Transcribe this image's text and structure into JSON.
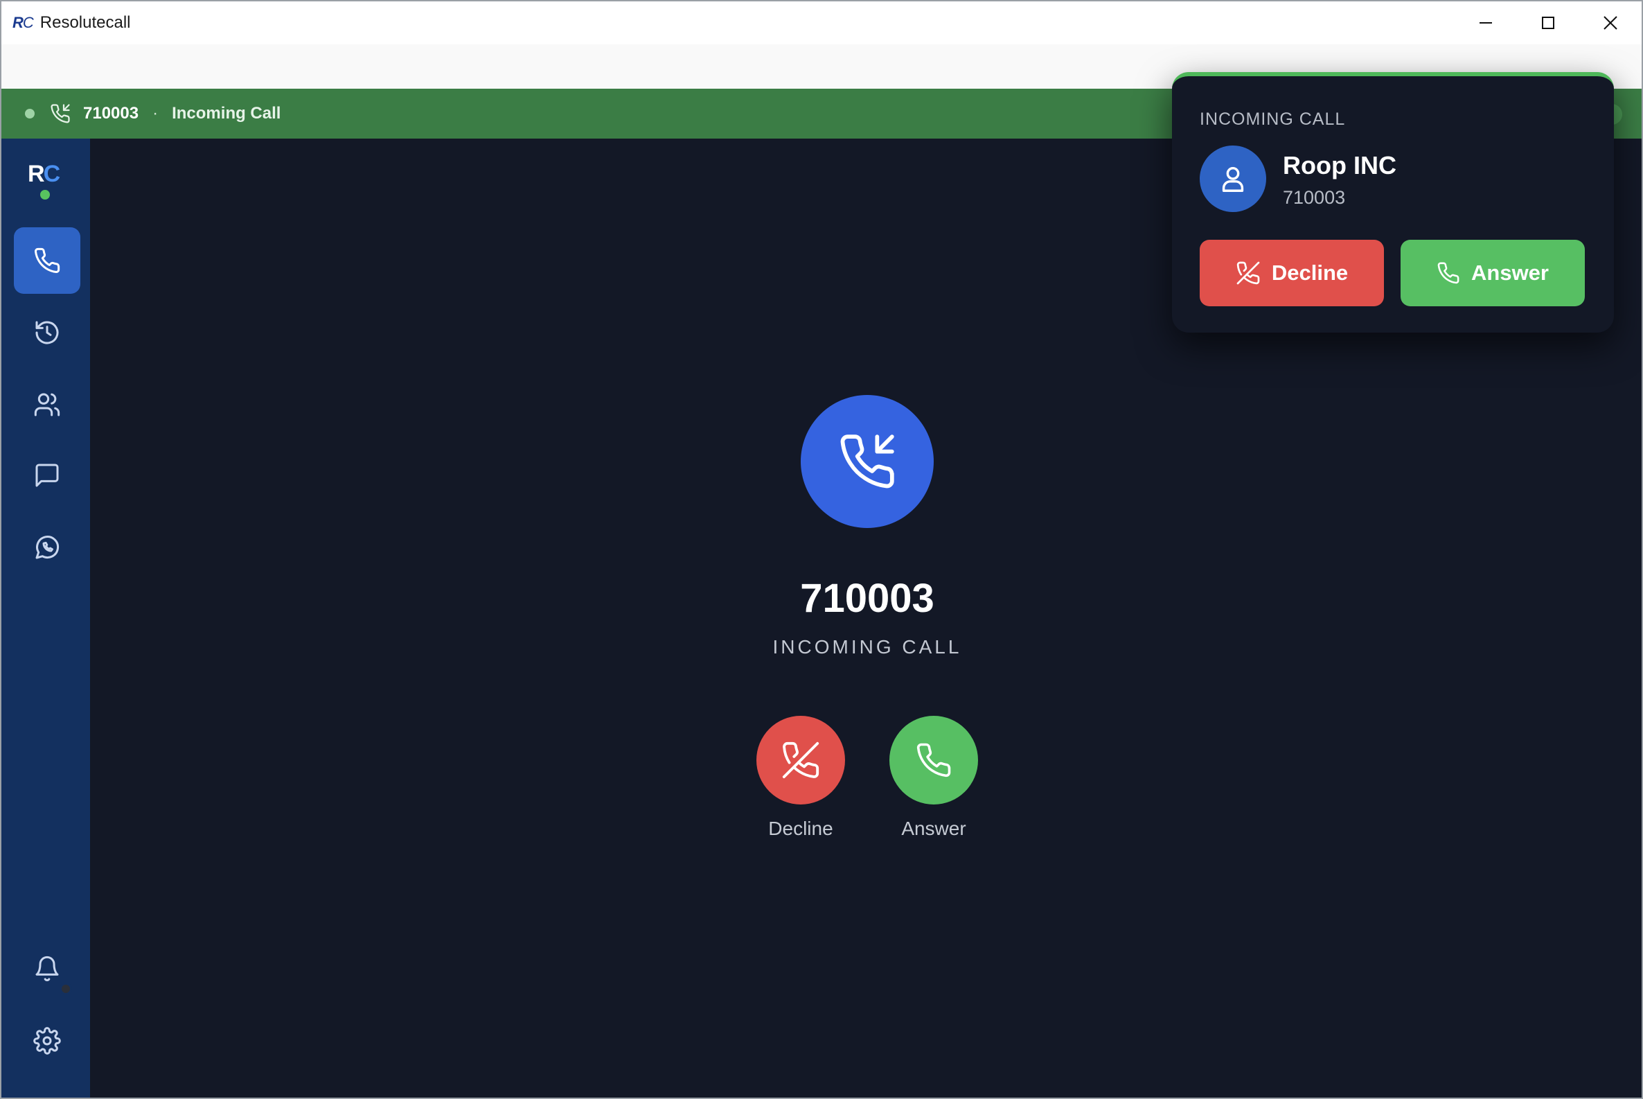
{
  "window": {
    "logo_text_r": "R",
    "logo_text_c": "C",
    "title": "Resolutecall",
    "controls": [
      "minimize-icon",
      "maximize-icon",
      "close-icon"
    ]
  },
  "status_bar": {
    "number": "710003",
    "separator": "·",
    "status": "Incoming Call",
    "color": "#3b7d45"
  },
  "sidebar": {
    "logo_r": "R",
    "logo_c": "C",
    "items": [
      {
        "icon": "phone-icon",
        "active": true
      },
      {
        "icon": "history-icon",
        "active": false
      },
      {
        "icon": "contacts-icon",
        "active": false
      },
      {
        "icon": "chat-icon",
        "active": false
      },
      {
        "icon": "whatsapp-icon",
        "active": false
      }
    ],
    "bottom_items": [
      {
        "icon": "bell-icon"
      },
      {
        "icon": "gear-icon"
      }
    ]
  },
  "main": {
    "number": "710003",
    "status": "INCOMING CALL",
    "decline_label": "Decline",
    "answer_label": "Answer"
  },
  "popup": {
    "heading": "INCOMING CALL",
    "name": "Roop INC",
    "number": "710003",
    "decline_label": "Decline",
    "answer_label": "Answer"
  },
  "colors": {
    "decline": "#e0504b",
    "answer": "#57bf63",
    "accent": "#3563e0",
    "sidebar": "#13305f",
    "background": "#131826"
  }
}
